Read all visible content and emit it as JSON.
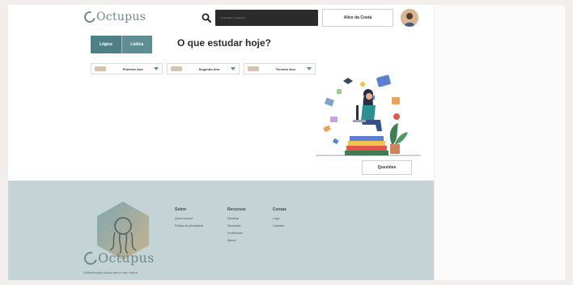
{
  "header": {
    "logo_text": "Octupus",
    "search": {
      "placeholder": "Pesquisar um assunto..."
    },
    "user_name": "Alice da Costa"
  },
  "tabs": [
    {
      "label": "Lógica",
      "active": true
    },
    {
      "label": "Lúdica",
      "active": false
    }
  ],
  "page_title": "O que estudar hoje?",
  "selectors": [
    {
      "label": "Primeiro Ano"
    },
    {
      "label": "Segundo Ano"
    },
    {
      "label": "Terceiro Ano"
    }
  ],
  "questions_button": "Questões",
  "footer": {
    "logo_text": "Octupus",
    "tagline": "Alfabetização lúdica para o seu futuro",
    "columns": [
      {
        "title": "Sobre",
        "links": [
          "Quem somos?",
          "Política de privacidade"
        ]
      },
      {
        "title": "Recursos",
        "links": [
          "Planilhas",
          "Simulados",
          "Professores",
          "Alunos"
        ]
      },
      {
        "title": "Contas",
        "links": [
          "Login",
          "Cadastro"
        ]
      }
    ]
  },
  "colors": {
    "accent": "#5e8d93",
    "footer_bg": "#c4d3d6",
    "search_bg": "#2b2b2b"
  },
  "icons": [
    "search-icon",
    "chevron-down-icon",
    "avatar",
    "octopus-logo-icon"
  ]
}
